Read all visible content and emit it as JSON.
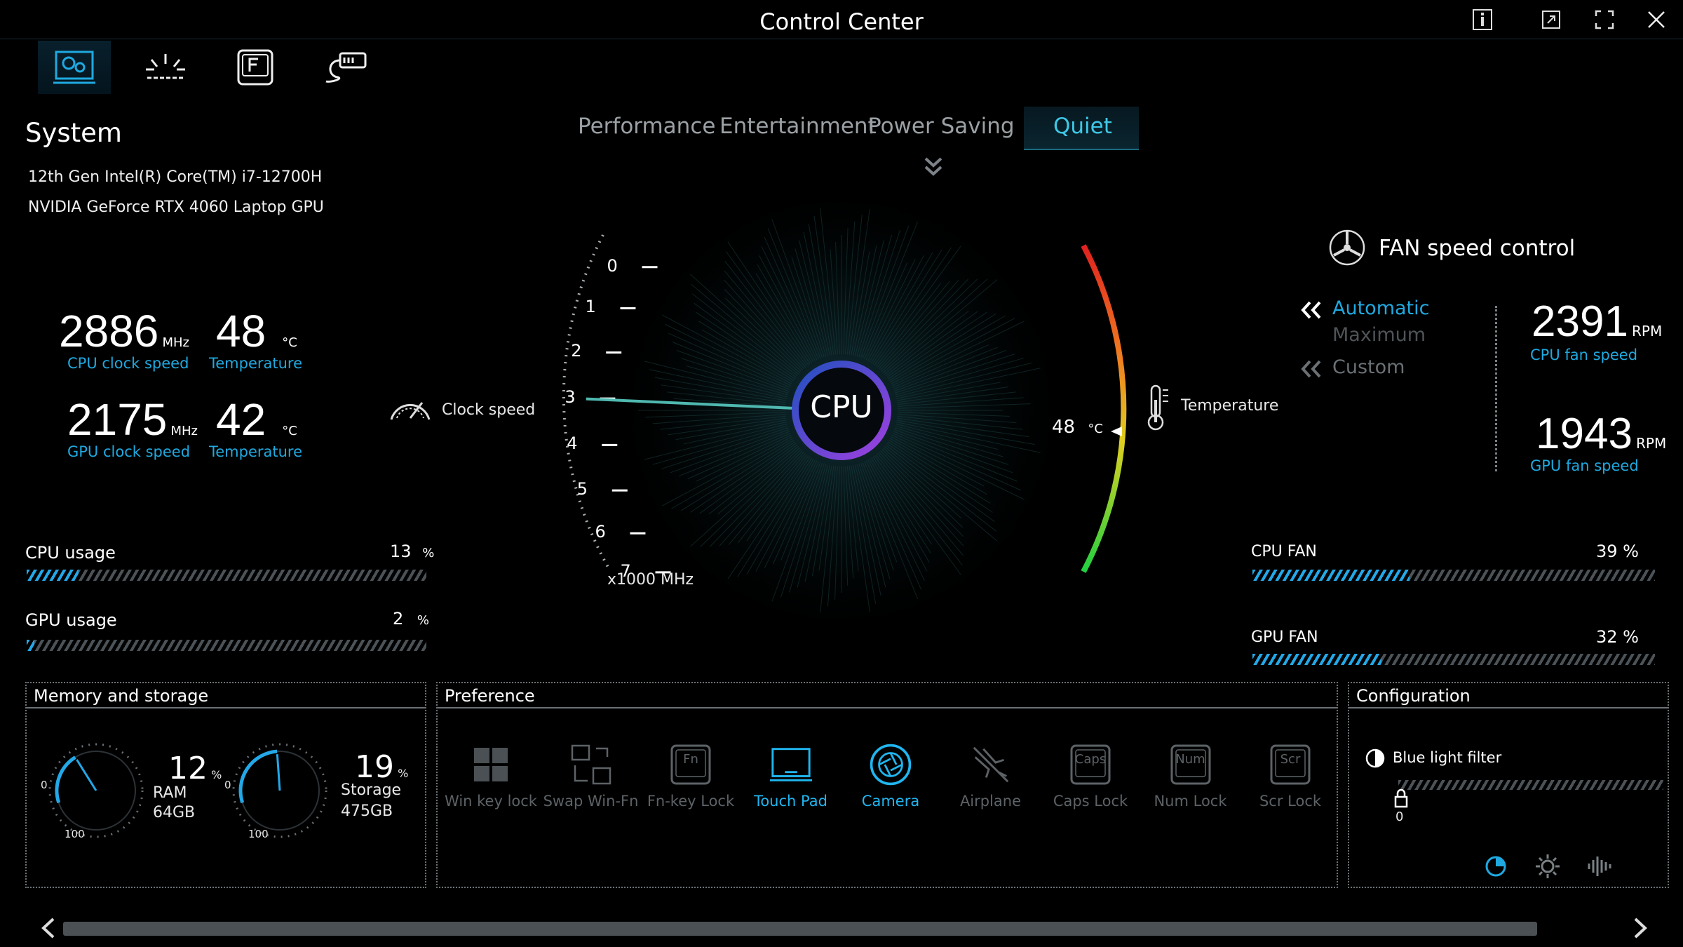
{
  "window": {
    "title": "Control Center"
  },
  "system": {
    "heading": "System",
    "cpu_name": "12th Gen Intel(R) Core(TM) i7-12700H",
    "gpu_name": "NVIDIA GeForce RTX 4060 Laptop GPU",
    "cpu_clock": {
      "value": "2886",
      "unit": "MHz",
      "label": "CPU clock speed"
    },
    "cpu_temp": {
      "value": "48",
      "unit": "°C",
      "label": "Temperature"
    },
    "gpu_clock": {
      "value": "2175",
      "unit": "MHz",
      "label": "GPU clock speed"
    },
    "gpu_temp": {
      "value": "42",
      "unit": "°C",
      "label": "Temperature"
    },
    "cpu_usage": {
      "label": "CPU usage",
      "value": "13",
      "unit": "%",
      "fraction": 0.13
    },
    "gpu_usage": {
      "label": "GPU usage",
      "value": "2",
      "unit": "%",
      "fraction": 0.02
    }
  },
  "modes": {
    "items": [
      "Performance",
      "Entertainment",
      "Power Saving",
      "Quiet"
    ],
    "active": "Quiet"
  },
  "dial": {
    "center_label": "CPU",
    "clock_label": "Clock speed",
    "scale_unit": "x1000 MHz",
    "scale_ticks": [
      "0",
      "1",
      "2",
      "3",
      "4",
      "5",
      "6",
      "7"
    ],
    "clock_ghz": 2.886,
    "temp_label": "Temperature",
    "temp_value": "48",
    "temp_unit": "°C"
  },
  "fan": {
    "heading": "FAN speed control",
    "modes": [
      "Automatic",
      "Maximum",
      "Custom"
    ],
    "active_mode": "Automatic",
    "cpu_rpm": {
      "value": "2391",
      "unit": "RPM",
      "label": "CPU fan speed"
    },
    "gpu_rpm": {
      "value": "1943",
      "unit": "RPM",
      "label": "GPU fan speed"
    },
    "cpu_fan": {
      "label": "CPU FAN",
      "value": "39 %",
      "fraction": 0.39
    },
    "gpu_fan": {
      "label": "GPU FAN",
      "value": "32 %",
      "fraction": 0.32
    }
  },
  "memory": {
    "heading": "Memory and storage",
    "ram": {
      "percent": "12",
      "unit": "%",
      "name": "RAM",
      "size": "64GB",
      "fraction": 0.12
    },
    "storage": {
      "percent": "19",
      "unit": "%",
      "name": "Storage",
      "size": "475GB",
      "fraction": 0.19
    },
    "gauge_min": "0",
    "gauge_max": "100"
  },
  "preference": {
    "heading": "Preference",
    "items": [
      {
        "label": "Win key lock",
        "icon": "windows-keys-icon",
        "on": false
      },
      {
        "label": "Swap Win-Fn",
        "icon": "swap-keys-icon",
        "on": false
      },
      {
        "label": "Fn-key Lock",
        "icon": "fn-key-icon",
        "on": false,
        "glyph": "Fn"
      },
      {
        "label": "Touch Pad",
        "icon": "touchpad-icon",
        "on": true
      },
      {
        "label": "Camera",
        "icon": "camera-icon",
        "on": true
      },
      {
        "label": "Airplane",
        "icon": "airplane-icon",
        "on": false
      },
      {
        "label": "Caps Lock",
        "icon": "caps-lock-icon",
        "on": false,
        "glyph": "Caps"
      },
      {
        "label": "Num Lock",
        "icon": "num-lock-icon",
        "on": false,
        "glyph": "Num"
      },
      {
        "label": "Scr Lock",
        "icon": "scroll-lock-icon",
        "on": false,
        "glyph": "Scr"
      }
    ]
  },
  "configuration": {
    "heading": "Configuration",
    "blue_light_label": "Blue light filter",
    "blue_light_value": "0"
  },
  "colors": {
    "accent": "#1fa9e0",
    "active_icon": "#20b6f0"
  }
}
